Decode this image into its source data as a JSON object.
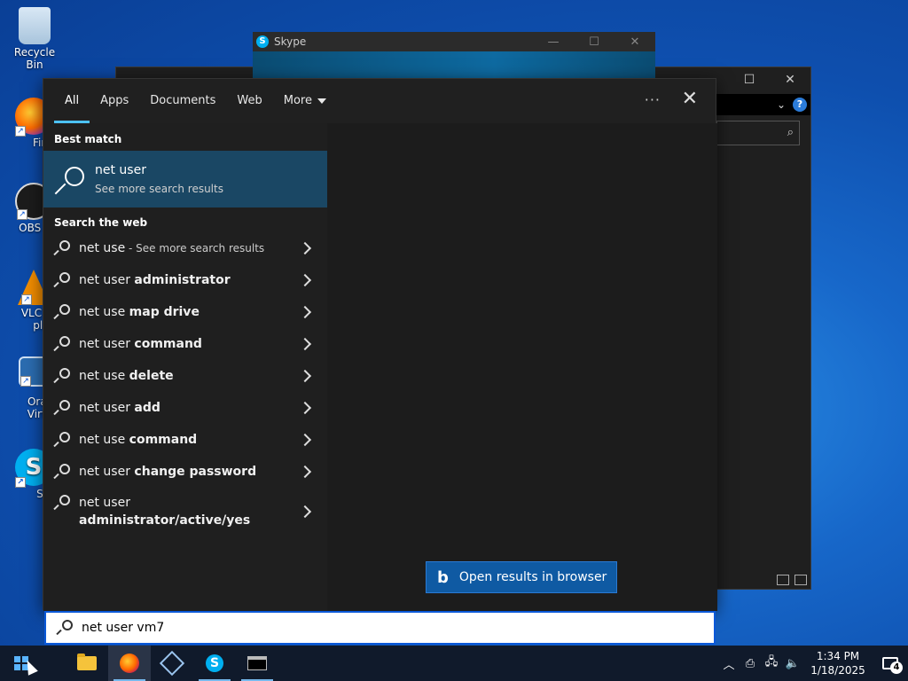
{
  "desktop": {
    "icons": [
      {
        "label": "Recycle Bin",
        "icon": "recycle-bin-icon"
      },
      {
        "label": "Firefo",
        "icon": "firefox-icon"
      },
      {
        "label": "OBS Stu",
        "icon": "obs-icon"
      },
      {
        "label": "VLC me\nplaye",
        "icon": "vlc-icon"
      },
      {
        "label": "Oracle\nVirtual",
        "icon": "virtualbox-icon"
      },
      {
        "label": "Skyp",
        "icon": "skype-icon"
      }
    ]
  },
  "skype_window": {
    "title": "Skype",
    "minimize": "—",
    "maximize": "☐",
    "close": "✕"
  },
  "explorer_window": {
    "maximize": "☐",
    "close": "✕",
    "help": "?"
  },
  "search_panel": {
    "tabs": [
      {
        "label": "All"
      },
      {
        "label": "Apps"
      },
      {
        "label": "Documents"
      },
      {
        "label": "Web"
      },
      {
        "label": "More"
      }
    ],
    "more_options": "···",
    "close": "✕",
    "best_match_heading": "Best match",
    "best_match": {
      "title": "net user",
      "subtitle": "See more search results"
    },
    "web_heading": "Search the web",
    "web_results": [
      {
        "prefix": "net use",
        "bold": "",
        "suffix": " - See more search results"
      },
      {
        "prefix": "net user ",
        "bold": "administrator",
        "suffix": ""
      },
      {
        "prefix": "net use ",
        "bold": "map drive",
        "suffix": ""
      },
      {
        "prefix": "net user ",
        "bold": "command",
        "suffix": ""
      },
      {
        "prefix": "net use ",
        "bold": "delete",
        "suffix": ""
      },
      {
        "prefix": "net user ",
        "bold": "add",
        "suffix": ""
      },
      {
        "prefix": "net use ",
        "bold": "command",
        "suffix": ""
      },
      {
        "prefix": "net user ",
        "bold": "change password",
        "suffix": ""
      },
      {
        "prefix": "net user",
        "bold": "administrator/active/yes",
        "suffix": ""
      }
    ],
    "open_browser_label": "Open results in browser",
    "bing_glyph": "b"
  },
  "search_box": {
    "value": "net user vm7"
  },
  "taskbar": {
    "apps": [
      "start",
      "file-explorer",
      "firefox",
      "virtualbox",
      "skype",
      "command-prompt"
    ],
    "tray": {
      "chevron": "︿",
      "time": "1:34 PM",
      "date": "1/18/2025",
      "notification_count": "4"
    }
  },
  "colors": {
    "accent": "#4cc2ff",
    "selection": "#1a4764",
    "taskbar": "#101a2b",
    "search_border": "#0a58d8"
  }
}
